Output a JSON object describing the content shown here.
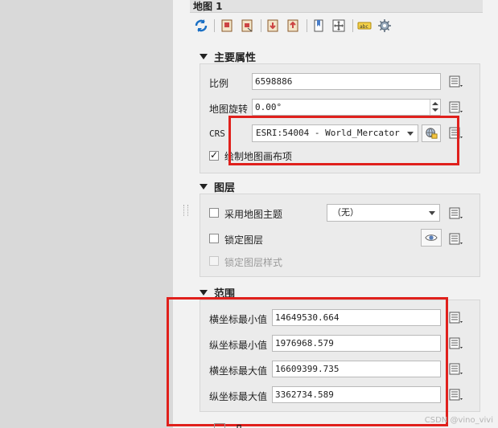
{
  "panel": {
    "title": "地图 1"
  },
  "toolbar": {
    "icons": [
      "refresh-icon",
      "add-item-icon",
      "remove-item-icon",
      "set-extent-icon",
      "view-extent-icon",
      "bookmark-icon",
      "move-content-icon",
      "label-icon",
      "settings-icon"
    ]
  },
  "main_props": {
    "header": "主要属性",
    "scale_label": "比例",
    "scale_value": "6598886",
    "rotation_label": "地图旋转",
    "rotation_value": "0.00°",
    "crs_label": "CRS",
    "crs_value": "ESRI:54004 - World_Mercator",
    "draw_items_label": "绘制地图画布项",
    "draw_items_checked": true
  },
  "layers": {
    "header": "图层",
    "follow_theme_label": "采用地图主题",
    "theme_value": "（无）",
    "lock_layers_label": "锁定图层",
    "lock_styles_label": "锁定图层样式"
  },
  "extents": {
    "header": "范围",
    "xmin_label": "横坐标最小值",
    "xmin_value": "14649530.664",
    "ymin_label": "纵坐标最小值",
    "ymin_value": "1976968.579",
    "xmax_label": "横坐标最大值",
    "xmax_value": "16609399.735",
    "ymax_label": "纵坐标最大值",
    "ymax_value": "3362734.589"
  },
  "next_section_partial": "Л",
  "watermark": "CSDN @vino_vivi",
  "colors": {
    "highlight": "#e0201c",
    "panel_bg": "#f2f2f2",
    "group_bg": "#ebebeb"
  }
}
